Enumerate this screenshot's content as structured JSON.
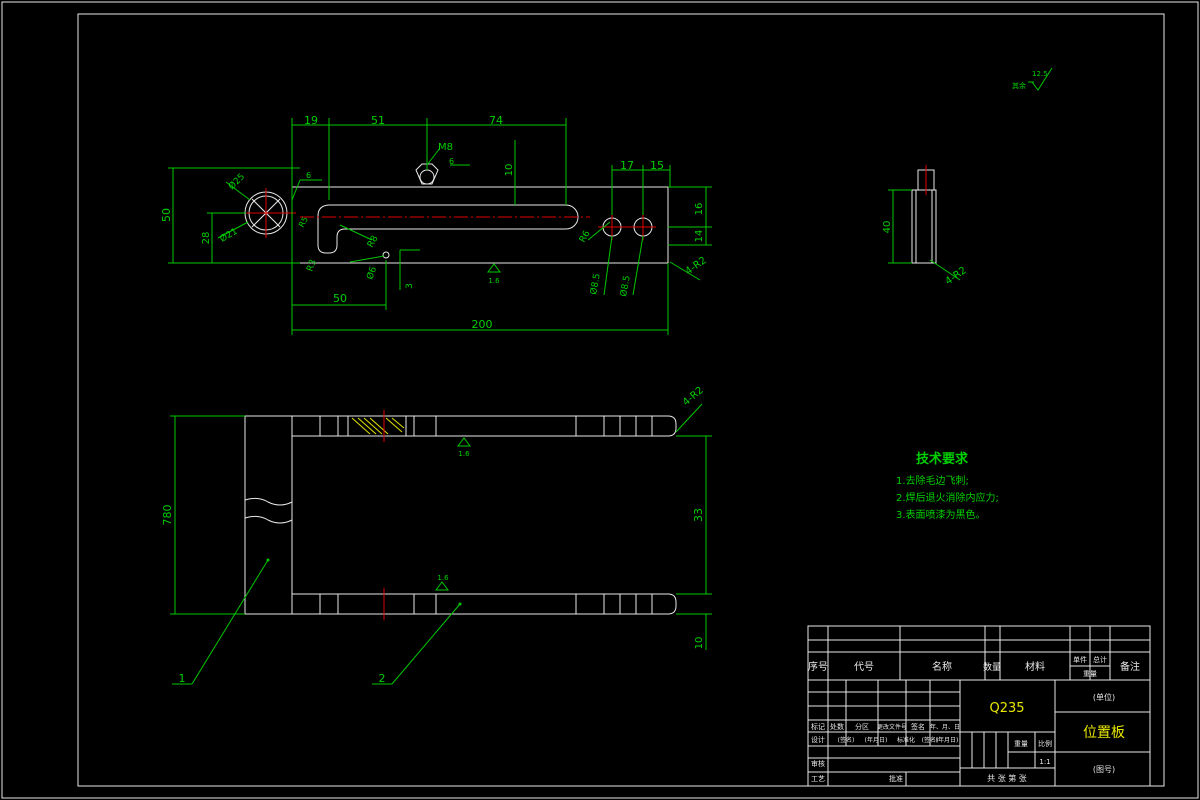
{
  "dims_top": {
    "d19": "19",
    "d51": "51",
    "d74": "74",
    "d17": "17",
    "d15": "15",
    "d10v": "10",
    "d16": "16",
    "d14": "14",
    "d50v": "50",
    "d28": "28",
    "d50h": "50",
    "d200": "200",
    "d3": "3",
    "phi25": "Ø25",
    "phi21": "Ø21",
    "m8": "M8",
    "r2": "4-R2",
    "phi8_5a": "Ø8.5",
    "phi8_5b": "Ø8.5",
    "r6": "R6",
    "r8": "R8",
    "r3": "R3",
    "phi6": "Ø6",
    "r5": "R5",
    "angle6a": "6",
    "angle6b": "6",
    "rough16": "1.6"
  },
  "dims_side": {
    "d40": "40",
    "r2": "4-R2"
  },
  "dims_front": {
    "d780": "780",
    "d33": "33",
    "d10": "10",
    "r2": "4-R2",
    "rough_a": "1.6",
    "rough_b": "1.6",
    "callout1": "1",
    "callout2": "2"
  },
  "roughness_corner": {
    "label": "其余",
    "value": "12.5"
  },
  "tech_requirements": {
    "title": "技术要求",
    "items": [
      "1.去除毛边飞刺;",
      "2.焊后退火消除内应力;",
      "3.表面喷漆为黑色。"
    ]
  },
  "title_block": {
    "h_seq": "序号",
    "h_code": "代号",
    "h_name": "名称",
    "h_qty": "数量",
    "h_material": "材料",
    "h_single": "单件",
    "h_total": "总计",
    "h_weight": "重量",
    "h_remark": "备注",
    "material": "Q235",
    "part_name": "位置板",
    "unit_name": "(单位)",
    "drawing_no": "(图号)",
    "r_mark": "标记",
    "r_count": "处数",
    "r_zone": "分区",
    "r_doc": "更改文件号",
    "r_sign": "签名",
    "r_date": "年、月、日",
    "r_design": "设计",
    "r_sign2": "(签名)",
    "r_ymd": "(年月日)",
    "r_std": "标准化",
    "r_sign3": "(签名)",
    "r_ymd2": "(年月日)",
    "r_check": "审核",
    "r_process": "工艺",
    "r_approve": "批准",
    "r_weight": "重量",
    "r_scale": "比例",
    "scale": "1:1",
    "sheets": "共  张  第  张"
  }
}
